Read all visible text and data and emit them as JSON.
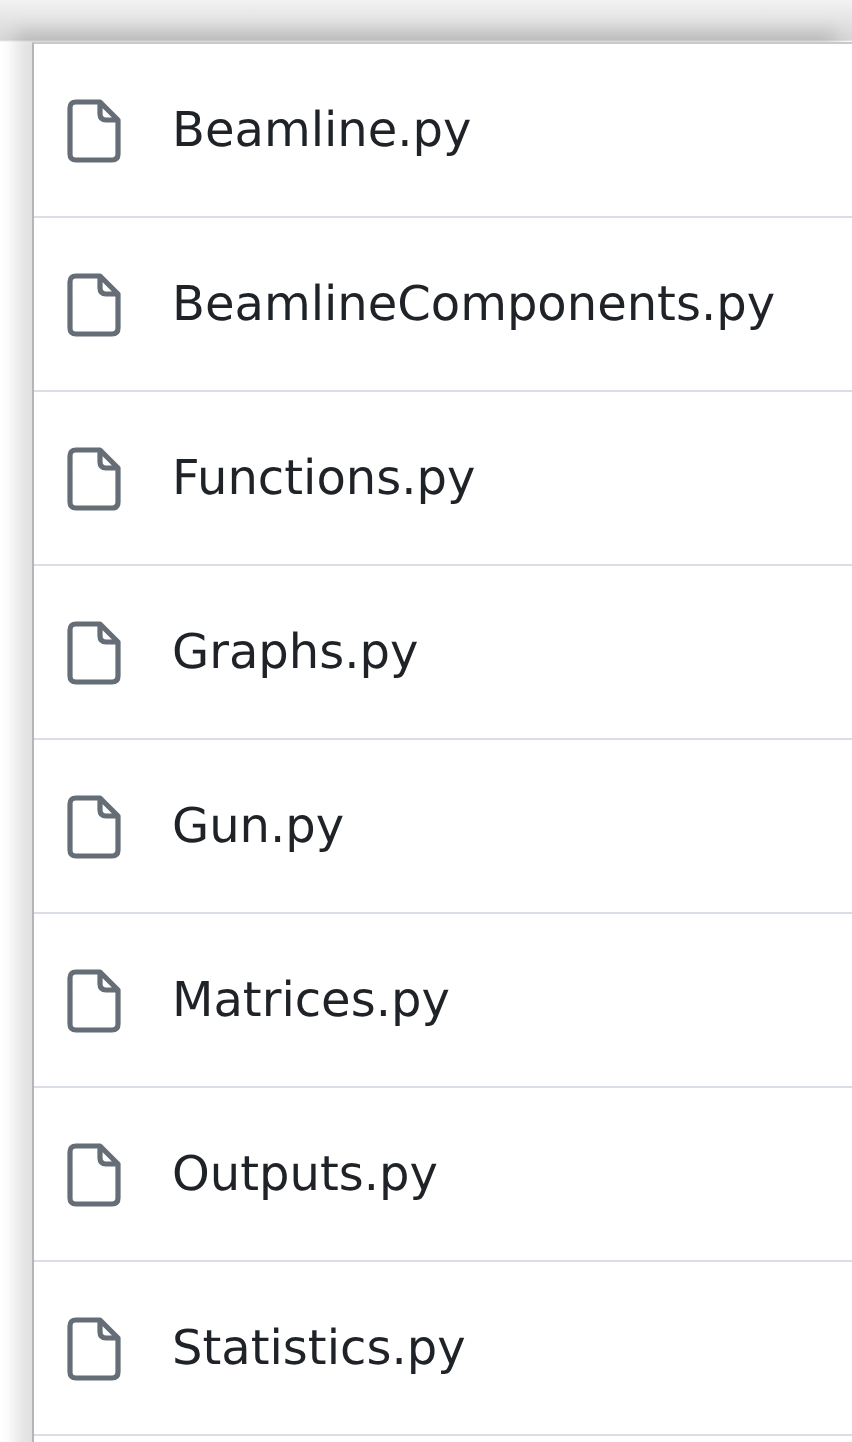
{
  "files": [
    {
      "name": "Beamline.py"
    },
    {
      "name": "BeamlineComponents.py"
    },
    {
      "name": "Functions.py"
    },
    {
      "name": "Graphs.py"
    },
    {
      "name": "Gun.py"
    },
    {
      "name": "Matrices.py"
    },
    {
      "name": "Outputs.py"
    },
    {
      "name": "Statistics.py"
    }
  ]
}
